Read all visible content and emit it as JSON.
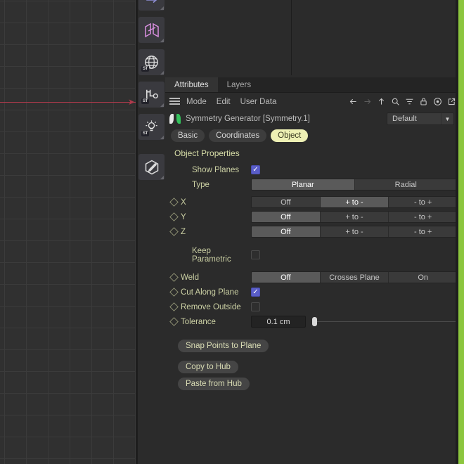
{
  "window": {
    "tabs": [
      {
        "label": "Attributes",
        "active": true
      },
      {
        "label": "Layers",
        "active": false
      }
    ],
    "menu": {
      "hamburger_icon": "hamburger-menu-icon",
      "items": [
        "Mode",
        "Edit",
        "User Data"
      ],
      "icons": [
        {
          "name": "back-arrow-icon",
          "glyph": "←",
          "dim": false
        },
        {
          "name": "forward-arrow-icon",
          "glyph": "→",
          "dim": true
        },
        {
          "name": "up-arrow-icon",
          "glyph": "↑",
          "dim": false
        },
        {
          "name": "search-icon",
          "glyph": "⌕",
          "dim": false
        },
        {
          "name": "filter-icon",
          "glyph": "≡",
          "dim": false
        },
        {
          "name": "lock-icon",
          "glyph": "⚿",
          "dim": false
        },
        {
          "name": "target-record-icon",
          "glyph": "◎",
          "dim": false
        },
        {
          "name": "open-external-icon",
          "glyph": "↗",
          "dim": false
        }
      ]
    },
    "object": {
      "icon": "symmetry-object-icon",
      "name": "Symmetry Generator [Symmetry.1]",
      "preset": "Default",
      "preset_arrow_icon": "chevron-down-icon"
    },
    "sub_tabs": [
      {
        "label": "Basic",
        "active": false
      },
      {
        "label": "Coordinates",
        "active": false
      },
      {
        "label": "Object",
        "active": true
      }
    ]
  },
  "properties": {
    "section_title": "Object Properties",
    "show_planes": {
      "label": "Show Planes",
      "checked": true
    },
    "type": {
      "label": "Type",
      "options": [
        "Planar",
        "Radial"
      ],
      "selected": "Planar"
    },
    "axes": [
      {
        "label": "X",
        "options": [
          "Off",
          "+ to -",
          "- to +"
        ],
        "selected": "+ to -"
      },
      {
        "label": "Y",
        "options": [
          "Off",
          "+ to -",
          "- to +"
        ],
        "selected": "Off"
      },
      {
        "label": "Z",
        "options": [
          "Off",
          "+ to -",
          "- to +"
        ],
        "selected": "Off"
      }
    ],
    "keep_parametric": {
      "label": "Keep Parametric",
      "checked": false
    },
    "weld": {
      "label": "Weld",
      "options": [
        "Off",
        "Crosses Plane",
        "On"
      ],
      "selected": "Off"
    },
    "cut_along_plane": {
      "label": "Cut Along Plane",
      "checked": true
    },
    "remove_outside": {
      "label": "Remove Outside",
      "checked": false
    },
    "tolerance": {
      "label": "Tolerance",
      "value": "0.1 cm",
      "slider_percent": 2
    },
    "buttons": [
      {
        "label": "Snap Points to Plane"
      },
      {
        "label": "Copy to Hub"
      },
      {
        "label": "Paste from Hub"
      }
    ]
  },
  "toolbar": {
    "items": [
      {
        "name": "array-arrow-tool",
        "badge": ""
      },
      {
        "name": "symmetry-tool",
        "badge": ""
      },
      {
        "name": "globe-tool",
        "badge": "ST"
      },
      {
        "name": "connector-tool",
        "badge": "ST"
      },
      {
        "name": "light-tool",
        "badge": "ST"
      },
      {
        "name": "sculpt-pen-tool",
        "badge": ""
      }
    ]
  },
  "viewport": {
    "axis_color": "#b03a4c",
    "grid_color": "#3b3b3b",
    "background": "#303030"
  },
  "colors": {
    "accent_green": "#8cc63e",
    "checkbox_blue": "#5a5ec8",
    "active_tab_yellow": "#eef0b4",
    "label_olive": "#ccd1a4"
  }
}
